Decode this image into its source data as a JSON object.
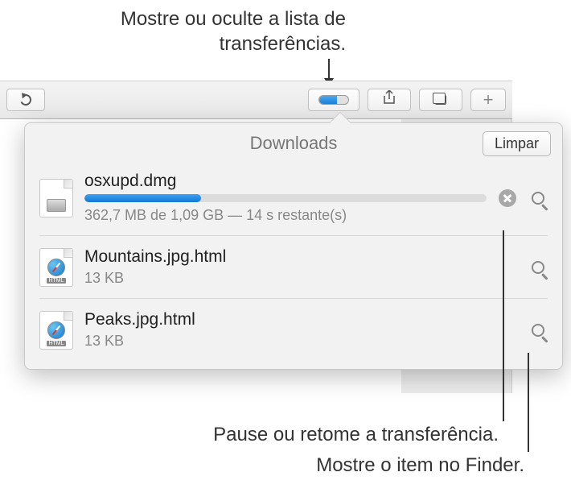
{
  "callouts": {
    "top": "Mostre ou oculte a lista de transferências.",
    "pause": "Pause ou retome a transferência.",
    "finder": "Mostre o item no Finder."
  },
  "popover": {
    "title": "Downloads",
    "clear_label": "Limpar"
  },
  "downloads": [
    {
      "name": "osxupd.dmg",
      "status": "362,7 MB de 1,09 GB — 14 s restante(s)",
      "progress_pct": 29,
      "in_progress": true,
      "kind": "dmg"
    },
    {
      "name": "Mountains.jpg.html",
      "status": "13 KB",
      "in_progress": false,
      "kind": "html"
    },
    {
      "name": "Peaks.jpg.html",
      "status": "13 KB",
      "in_progress": false,
      "kind": "html"
    }
  ]
}
